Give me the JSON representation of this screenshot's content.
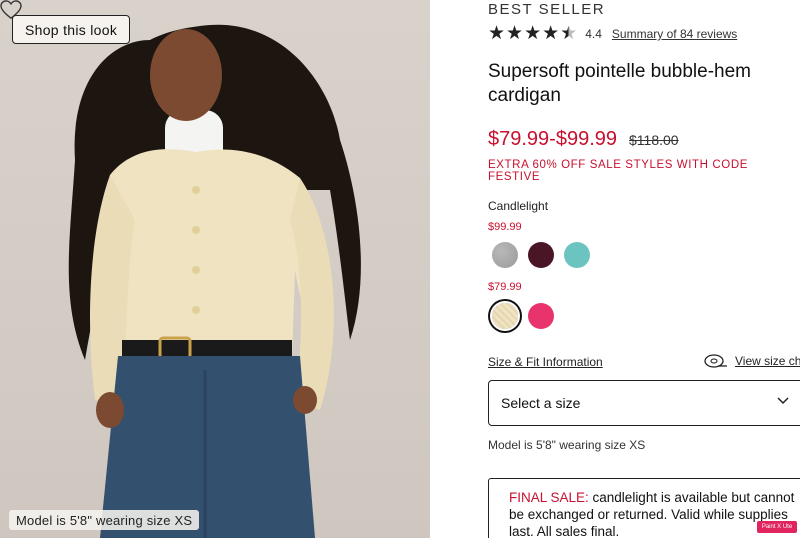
{
  "photo": {
    "shop_look_label": "Shop this look",
    "model_caption": "Model is 5'8\" wearing size XS"
  },
  "product": {
    "badge": "BEST SELLER",
    "rating": {
      "stars": 4.4,
      "value_text": "4.4",
      "reviews_link": "Summary of 84 reviews"
    },
    "title": "Supersoft pointelle bubble-hem cardigan",
    "price_range": "$79.99-$99.99",
    "original_price": "$118.00",
    "promo": "EXTRA 60% OFF SALE STYLES WITH CODE FESTIVE",
    "selected_color": "Candlelight",
    "price_tiers": [
      {
        "price": "$99.99",
        "swatches": [
          {
            "name": "heather grey",
            "color": "#9a9a9a"
          },
          {
            "name": "burgundy",
            "color": "#4a1524"
          },
          {
            "name": "aqua",
            "color": "#6cc4c0"
          }
        ]
      },
      {
        "price": "$79.99",
        "swatches": [
          {
            "name": "candlelight",
            "color": "#efe3c2",
            "selected": true
          },
          {
            "name": "pink",
            "color": "#e8336c"
          }
        ]
      }
    ],
    "size_fit_link": "Size & Fit Information",
    "view_size_chart": "View size ch",
    "size_select_placeholder": "Select a size",
    "model_note": "Model is 5'8\" wearing size XS",
    "final_sale": {
      "label": "FINAL SALE:",
      "text": " candlelight is available but cannot be exchanged or returned. Valid while supplies last. All sales final."
    }
  },
  "extension_badge": "Paint X Ute",
  "colors": {
    "sale_red": "#c8102e",
    "ink": "#111111"
  }
}
